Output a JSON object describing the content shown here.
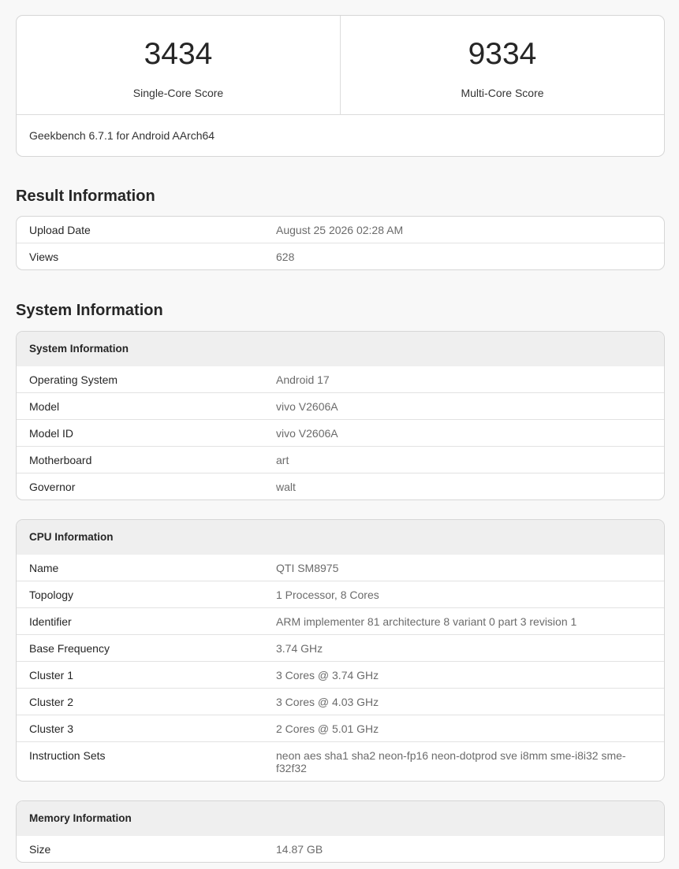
{
  "scores": {
    "single": {
      "value": "3434",
      "label": "Single-Core Score"
    },
    "multi": {
      "value": "9334",
      "label": "Multi-Core Score"
    },
    "footer": "Geekbench 6.7.1 for Android AArch64"
  },
  "result_information": {
    "title": "Result Information",
    "rows": [
      {
        "key": "Upload Date",
        "value": "August 25 2026 02:28 AM"
      },
      {
        "key": "Views",
        "value": "628"
      }
    ]
  },
  "system_information": {
    "title": "System Information",
    "system_table": {
      "header": "System Information",
      "rows": [
        {
          "key": "Operating System",
          "value": "Android 17"
        },
        {
          "key": "Model",
          "value": "vivo V2606A"
        },
        {
          "key": "Model ID",
          "value": "vivo V2606A"
        },
        {
          "key": "Motherboard",
          "value": "art"
        },
        {
          "key": "Governor",
          "value": "walt"
        }
      ]
    },
    "cpu_table": {
      "header": "CPU Information",
      "rows": [
        {
          "key": "Name",
          "value": "QTI SM8975"
        },
        {
          "key": "Topology",
          "value": "1 Processor, 8 Cores"
        },
        {
          "key": "Identifier",
          "value": "ARM implementer 81 architecture 8 variant 0 part 3 revision 1"
        },
        {
          "key": "Base Frequency",
          "value": "3.74 GHz"
        },
        {
          "key": "Cluster 1",
          "value": "3 Cores @ 3.74 GHz"
        },
        {
          "key": "Cluster 2",
          "value": "3 Cores @ 4.03 GHz"
        },
        {
          "key": "Cluster 3",
          "value": "2 Cores @ 5.01 GHz"
        },
        {
          "key": "Instruction Sets",
          "value": "neon aes sha1 sha2 neon-fp16 neon-dotprod sve i8mm sme-i8i32 sme-f32f32"
        }
      ]
    },
    "memory_table": {
      "header": "Memory Information",
      "rows": [
        {
          "key": "Size",
          "value": "14.87 GB"
        }
      ]
    }
  }
}
